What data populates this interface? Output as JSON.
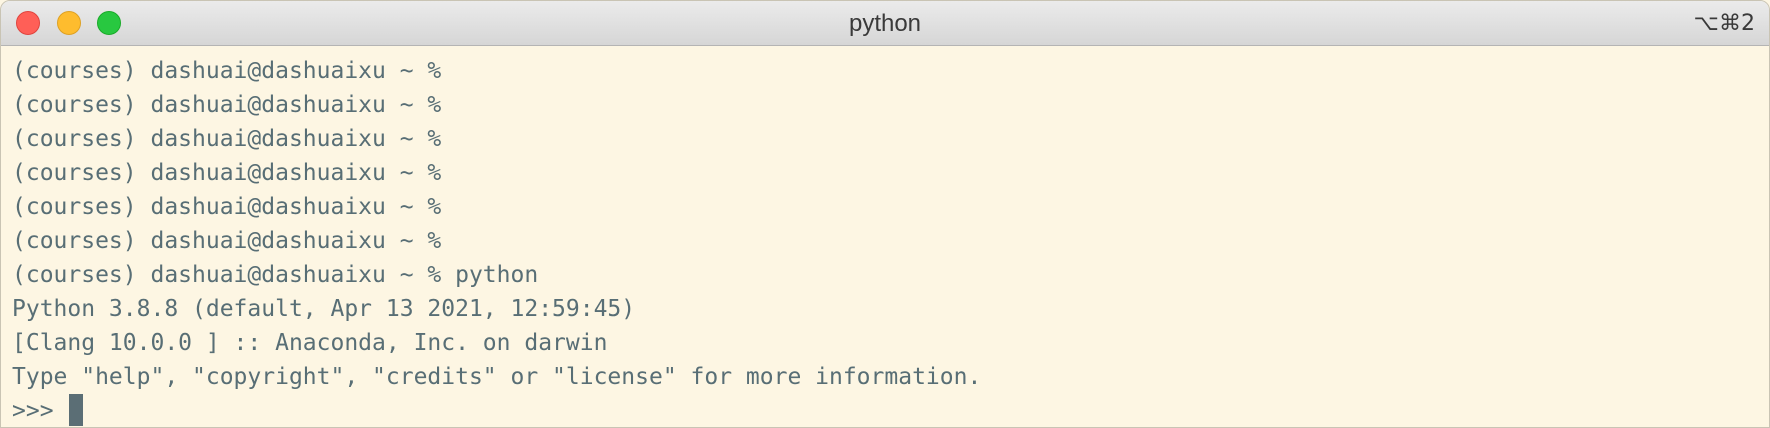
{
  "window": {
    "title": "python",
    "shortcut": "⌥⌘2",
    "buttons": {
      "close": "close-icon",
      "minimize": "minimize-icon",
      "zoom": "zoom-icon"
    }
  },
  "terminal": {
    "lines": [
      "(courses) dashuai@dashuaixu ~ %",
      "(courses) dashuai@dashuaixu ~ %",
      "(courses) dashuai@dashuaixu ~ %",
      "(courses) dashuai@dashuaixu ~ %",
      "(courses) dashuai@dashuaixu ~ %",
      "(courses) dashuai@dashuaixu ~ %",
      "(courses) dashuai@dashuaixu ~ % python",
      "Python 3.8.8 (default, Apr 13 2021, 12:59:45)",
      "[Clang 10.0.0 ] :: Anaconda, Inc. on darwin",
      "Type \"help\", \"copyright\", \"credits\" or \"license\" for more information."
    ],
    "repl_prompt": ">>> "
  },
  "colors": {
    "background": "#fdf6e3",
    "text": "#586e75",
    "cursor": "#5b6e75"
  }
}
